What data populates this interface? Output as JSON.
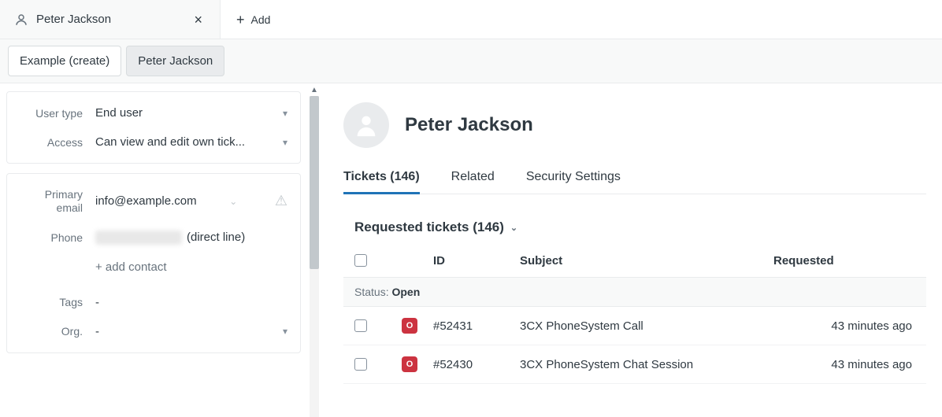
{
  "top_tab": {
    "label": "Peter Jackson"
  },
  "add_tab_label": "Add",
  "sub_tabs": [
    {
      "label": "Example (create)",
      "active": false
    },
    {
      "label": "Peter Jackson",
      "active": true
    }
  ],
  "sidebar": {
    "user_type": {
      "label": "User type",
      "value": "End user"
    },
    "access": {
      "label": "Access",
      "value": "Can view and edit own tick..."
    },
    "primary_email": {
      "label": "Primary email",
      "value": "info@example.com"
    },
    "phone": {
      "label": "Phone",
      "suffix": "(direct line)"
    },
    "add_contact": "+ add contact",
    "tags": {
      "label": "Tags",
      "value": "-"
    },
    "org": {
      "label": "Org.",
      "value": "-"
    }
  },
  "profile": {
    "name": "Peter Jackson"
  },
  "content_tabs": {
    "tickets": "Tickets (146)",
    "related": "Related",
    "security": "Security Settings"
  },
  "section_title": "Requested tickets (146)",
  "table": {
    "headers": {
      "id": "ID",
      "subject": "Subject",
      "requested": "Requested"
    },
    "status_label": "Status:",
    "status_value": "Open",
    "rows": [
      {
        "badge": "O",
        "id": "#52431",
        "subject": "3CX PhoneSystem Call",
        "requested": "43 minutes ago"
      },
      {
        "badge": "O",
        "id": "#52430",
        "subject": "3CX PhoneSystem Chat Session",
        "requested": "43 minutes ago"
      }
    ]
  }
}
